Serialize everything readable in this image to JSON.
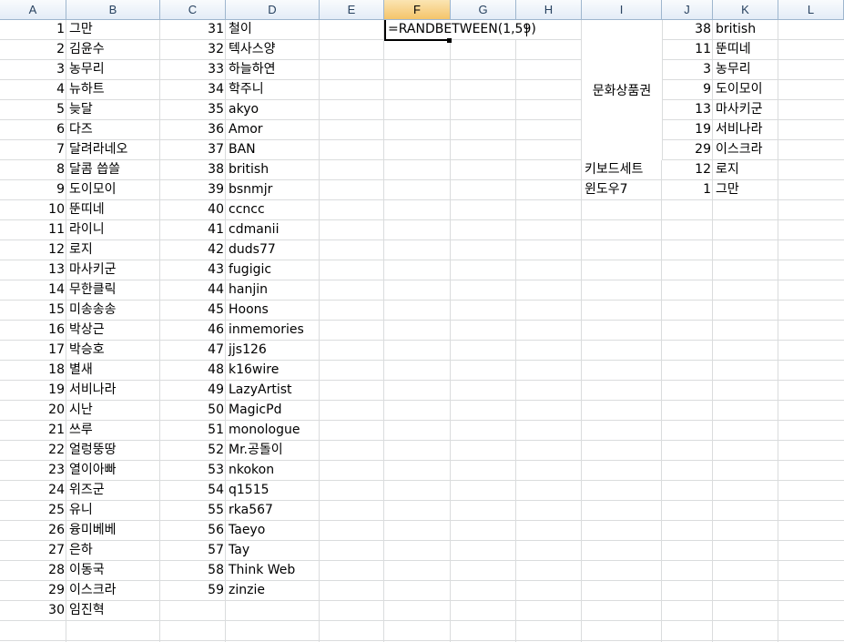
{
  "columns": [
    {
      "label": "A"
    },
    {
      "label": "B"
    },
    {
      "label": "C"
    },
    {
      "label": "D"
    },
    {
      "label": "E"
    },
    {
      "label": "F"
    },
    {
      "label": "G"
    },
    {
      "label": "H"
    },
    {
      "label": "I"
    },
    {
      "label": "J"
    },
    {
      "label": "K"
    },
    {
      "label": "L"
    }
  ],
  "active_cell": {
    "column": "F",
    "row": 1,
    "formula": "=RANDBETWEEN(1,59)"
  },
  "list_a": [
    [
      "1",
      "그만"
    ],
    [
      "2",
      "김윤수"
    ],
    [
      "3",
      "농무리"
    ],
    [
      "4",
      "뉴하트"
    ],
    [
      "5",
      "늦달"
    ],
    [
      "6",
      "다즈"
    ],
    [
      "7",
      "달려라네오"
    ],
    [
      "8",
      "달콤 씁쓸"
    ],
    [
      "9",
      "도이모이"
    ],
    [
      "10",
      "뚠띠네"
    ],
    [
      "11",
      "라이니"
    ],
    [
      "12",
      "로지"
    ],
    [
      "13",
      "마사키군"
    ],
    [
      "14",
      "무한클릭"
    ],
    [
      "15",
      "미송송송"
    ],
    [
      "16",
      "박상근"
    ],
    [
      "17",
      "박승호"
    ],
    [
      "18",
      "별새"
    ],
    [
      "19",
      "서비나라"
    ],
    [
      "20",
      "시난"
    ],
    [
      "21",
      "쓰루"
    ],
    [
      "22",
      "얼렁뚱땅"
    ],
    [
      "23",
      "열이아빠"
    ],
    [
      "24",
      "위즈군"
    ],
    [
      "25",
      "유니"
    ],
    [
      "26",
      "융미베베"
    ],
    [
      "27",
      "은하"
    ],
    [
      "28",
      "이동국"
    ],
    [
      "29",
      "이스크라"
    ],
    [
      "30",
      "임진혁"
    ]
  ],
  "list_b": [
    [
      "31",
      "철이"
    ],
    [
      "32",
      "텍사스양"
    ],
    [
      "33",
      "하늘하연"
    ],
    [
      "34",
      "학주니"
    ],
    [
      "35",
      "akyo"
    ],
    [
      "36",
      "Amor"
    ],
    [
      "37",
      "BAN"
    ],
    [
      "38",
      "british"
    ],
    [
      "39",
      "bsnmjr"
    ],
    [
      "40",
      "ccncc"
    ],
    [
      "41",
      "cdmanii"
    ],
    [
      "42",
      "duds77"
    ],
    [
      "43",
      "fugigic"
    ],
    [
      "44",
      "hanjin"
    ],
    [
      "45",
      "Hoons"
    ],
    [
      "46",
      "inmemories"
    ],
    [
      "47",
      "jjs126"
    ],
    [
      "48",
      "k16wire"
    ],
    [
      "49",
      "LazyArtist"
    ],
    [
      "50",
      "MagicPd"
    ],
    [
      "51",
      "monologue"
    ],
    [
      "52",
      "Mr.공돌이"
    ],
    [
      "53",
      "nkokon"
    ],
    [
      "54",
      "q1515"
    ],
    [
      "55",
      "rka567"
    ],
    [
      "56",
      "Taeyo"
    ],
    [
      "57",
      "Tay"
    ],
    [
      "58",
      "Think Web"
    ],
    [
      "59",
      "zinzie"
    ]
  ],
  "prizes": {
    "merged_label": "문화상품권",
    "row8_label": "키보드세트",
    "row9_label": "윈도우7"
  },
  "winners": [
    [
      "38",
      "british"
    ],
    [
      "11",
      "뚠띠네"
    ],
    [
      "3",
      "농무리"
    ],
    [
      "9",
      "도이모이"
    ],
    [
      "13",
      "마사키군"
    ],
    [
      "19",
      "서비나라"
    ],
    [
      "29",
      "이스크라"
    ],
    [
      "12",
      "로지"
    ],
    [
      "1",
      "그만"
    ]
  ],
  "colors": {
    "header_bg": "#e4ecf7",
    "selected_header": "#f4c46a",
    "gridline": "#dadcdd"
  }
}
